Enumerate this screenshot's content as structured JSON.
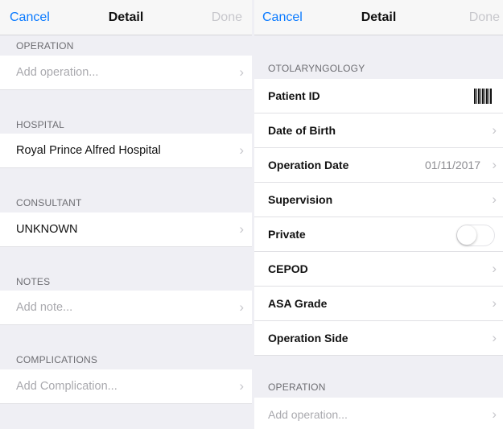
{
  "left": {
    "nav": {
      "cancel": "Cancel",
      "title": "Detail",
      "done": "Done"
    },
    "sections": {
      "operation": {
        "header": "OPERATION",
        "placeholder": "Add operation..."
      },
      "hospital": {
        "header": "HOSPITAL",
        "value": "Royal Prince Alfred Hospital"
      },
      "consultant": {
        "header": "CONSULTANT",
        "value": "UNKNOWN"
      },
      "notes": {
        "header": "NOTES",
        "placeholder": "Add note..."
      },
      "complications": {
        "header": "COMPLICATIONS",
        "placeholder": "Add Complication..."
      }
    }
  },
  "right": {
    "nav": {
      "cancel": "Cancel",
      "title": "Detail",
      "done": "Done"
    },
    "specialty_header": "OTOLARYNGOLOGY",
    "rows": {
      "patient_id": "Patient ID",
      "date_of_birth": "Date of Birth",
      "operation_date": "Operation Date",
      "operation_date_value": "01/11/2017",
      "supervision": "Supervision",
      "private": "Private",
      "private_on": false,
      "cepod": "CEPOD",
      "asa_grade": "ASA Grade",
      "operation_side": "Operation Side"
    },
    "operation": {
      "header": "OPERATION",
      "placeholder": "Add operation..."
    }
  },
  "icons": {
    "chevron": "›",
    "barcode": "barcode-icon",
    "toggle": "toggle-switch"
  },
  "colors": {
    "accent": "#0a7aff",
    "disabled": "#c7c7cc",
    "background": "#efeff4"
  }
}
